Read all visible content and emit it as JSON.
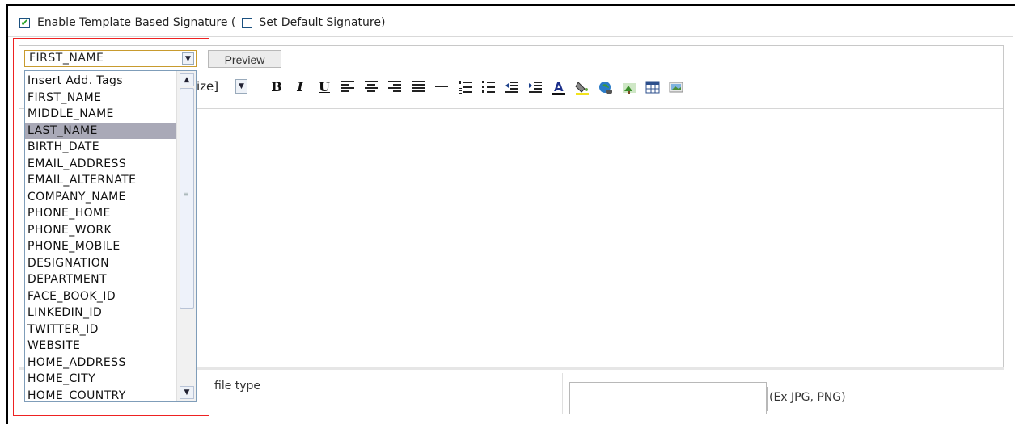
{
  "signature": {
    "enable_template_label": "Enable Template Based Signature (",
    "enable_template_checked": true,
    "set_default_label": "Set Default Signature)",
    "set_default_checked": false
  },
  "tags_combo": {
    "selected": "FIRST_NAME",
    "options": [
      "Insert Add. Tags",
      "FIRST_NAME",
      "MIDDLE_NAME",
      "LAST_NAME",
      "BIRTH_DATE",
      "EMAIL_ADDRESS",
      "EMAIL_ALTERNATE",
      "COMPANY_NAME",
      "PHONE_HOME",
      "PHONE_WORK",
      "PHONE_MOBILE",
      "DESIGNATION",
      "DEPARTMENT",
      "FACE_BOOK_ID",
      "LINKEDIN_ID",
      "TWITTER_ID",
      "WEBSITE",
      "HOME_ADDRESS",
      "HOME_CITY",
      "HOME_COUNTRY"
    ],
    "highlighted": "LAST_NAME"
  },
  "preview_button": "Preview",
  "toolbar": {
    "font_size_fragment": "ize]",
    "bold": "B",
    "italic": "I",
    "underline": "U",
    "icons": [
      "bold-icon",
      "italic-icon",
      "underline-icon",
      "align-left-icon",
      "align-center-icon",
      "align-right-icon",
      "justify-icon",
      "horizontal-rule-icon",
      "ordered-list-icon",
      "unordered-list-icon",
      "outdent-icon",
      "indent-icon",
      "font-color-icon",
      "highlight-color-icon",
      "insert-link-icon",
      "insert-image-icon",
      "insert-table-icon",
      "image-gallery-icon"
    ]
  },
  "attachment": {
    "label_visible": "file type",
    "hint": "(Ex JPG, PNG)"
  },
  "colors": {
    "highlight_border": "#e22222",
    "selected_option_bg": "#a9a9b7",
    "check_green": "#21a121"
  }
}
